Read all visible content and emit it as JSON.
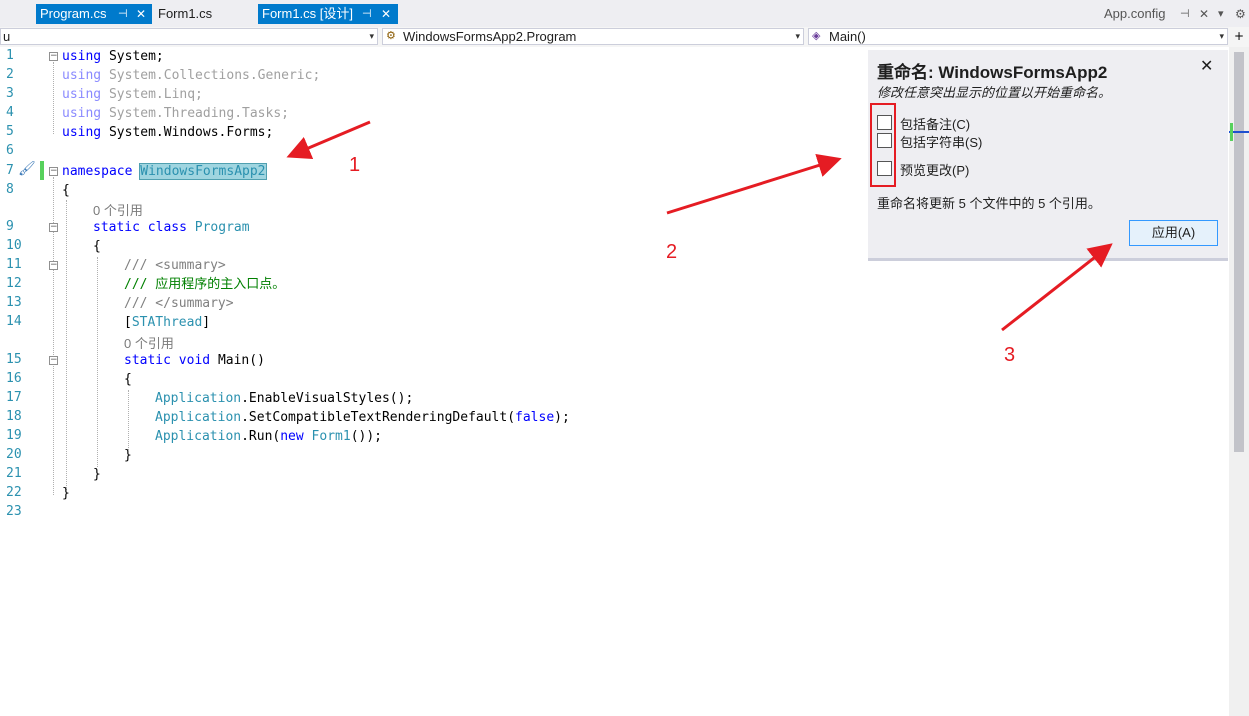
{
  "tabs": [
    {
      "label": "Program.cs",
      "active": true
    },
    {
      "label": "Form1.cs",
      "active": false
    },
    {
      "label": "Form1.cs [设计]",
      "active": true
    }
  ],
  "tab_right": {
    "label": "App.config"
  },
  "icons": {
    "pin": "⊣",
    "close": "✕",
    "dropdown": "▾",
    "gear": "⚙"
  },
  "navbar": {
    "left": "u",
    "middle": "WindowsFormsApp2.Program",
    "right": "Main()"
  },
  "editor": {
    "line_numbers": [
      "1",
      "2",
      "3",
      "4",
      "5",
      "6",
      "7",
      "8",
      "9",
      "10",
      "11",
      "12",
      "13",
      "14",
      "15",
      "16",
      "17",
      "18",
      "19",
      "20",
      "21",
      "22",
      "23"
    ],
    "code": {
      "using": "using",
      "ns1": "System;",
      "ns2": "System.Collections.Generic;",
      "ns3": "System.Linq;",
      "ns4": "System.Threading.Tasks;",
      "ns5": "System.Windows.Forms;",
      "namespace_kw": "namespace",
      "namespace_name": "WindowsFormsApp2",
      "open_brace": "{",
      "close_brace": "}",
      "static": "static",
      "class": "class",
      "class_name": "Program",
      "summary_open": "/// <summary>",
      "summary_text": "/// 应用程序的主入口点。",
      "summary_close": "/// </summary>",
      "attr_open": "[",
      "attr": "STAThread",
      "attr_close": "]",
      "void": "void",
      "method": "Main()",
      "application": "Application",
      "call1": ".EnableVisualStyles();",
      "call2": ".SetCompatibleTextRenderingDefault(",
      "false_kw": "false",
      "call2_end": ");",
      "call3": ".Run(",
      "new_kw": "new",
      "form1": "Form1",
      "call3_end": "());"
    },
    "ref_count_1": "0 个引用",
    "ref_count_2": "0 个引用"
  },
  "rename_panel": {
    "title": "重命名: WindowsFormsApp2",
    "subtitle": "修改任意突出显示的位置以开始重命名。",
    "options": [
      {
        "label": "包括备注(C)",
        "checked": false
      },
      {
        "label": "包括字符串(S)",
        "checked": false
      },
      {
        "label": "预览更改(P)",
        "checked": false
      }
    ],
    "info": "重命名将更新 5 个文件中的 5 个引用。",
    "apply_label": "应用(A)"
  },
  "annotations": {
    "n1": "1",
    "n2": "2",
    "n3": "3"
  },
  "colors": {
    "accent": "#007acc",
    "annotation": "#e51c23",
    "keyword": "#0000ff",
    "type": "#2b91af",
    "comment": "#008000"
  }
}
